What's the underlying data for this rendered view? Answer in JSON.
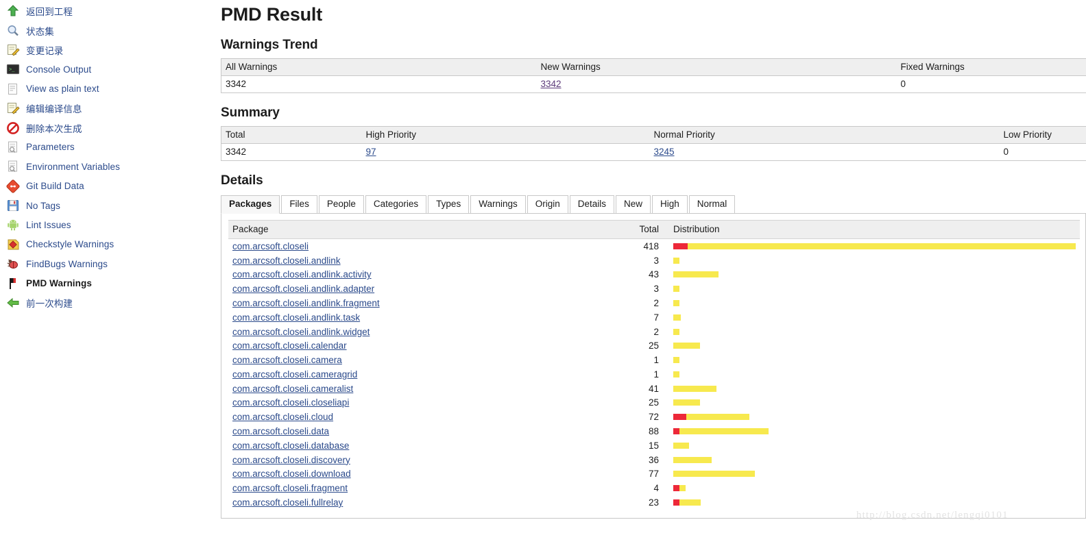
{
  "sidebar": {
    "items": [
      {
        "label": "返回到工程",
        "icon": "up-arrow-green-icon",
        "bold": false
      },
      {
        "label": "状态集",
        "icon": "magnifier-icon",
        "bold": false
      },
      {
        "label": "变更记录",
        "icon": "notepad-pencil-icon",
        "bold": false
      },
      {
        "label": "Console Output",
        "icon": "terminal-icon",
        "bold": false
      },
      {
        "label": "View as plain text",
        "icon": "document-icon",
        "bold": false
      },
      {
        "label": "编辑编译信息",
        "icon": "notepad-pencil-icon",
        "bold": false
      },
      {
        "label": "删除本次生成",
        "icon": "no-entry-icon",
        "bold": false
      },
      {
        "label": "Parameters",
        "icon": "document-search-icon",
        "bold": false
      },
      {
        "label": "Environment Variables",
        "icon": "document-search-icon",
        "bold": false
      },
      {
        "label": "Git Build Data",
        "icon": "git-diamond-icon",
        "bold": false
      },
      {
        "label": "No Tags",
        "icon": "floppy-disk-icon",
        "bold": false
      },
      {
        "label": "Lint Issues",
        "icon": "android-icon",
        "bold": false
      },
      {
        "label": "Checkstyle Warnings",
        "icon": "checkstyle-icon",
        "bold": false
      },
      {
        "label": "FindBugs Warnings",
        "icon": "bug-icon",
        "bold": false
      },
      {
        "label": "PMD Warnings",
        "icon": "pmd-flag-icon",
        "bold": true
      },
      {
        "label": "前一次构建",
        "icon": "left-arrow-green-icon",
        "bold": false
      }
    ]
  },
  "main": {
    "page_title": "PMD Result",
    "trend": {
      "heading": "Warnings Trend",
      "headers": [
        "All Warnings",
        "New Warnings",
        "Fixed Warnings"
      ],
      "row": {
        "all": "3342",
        "new": "3342",
        "fixed": "0"
      }
    },
    "summary": {
      "heading": "Summary",
      "headers": [
        "Total",
        "High Priority",
        "Normal Priority",
        "Low Priority"
      ],
      "row": {
        "total": "3342",
        "high": "97",
        "normal": "3245",
        "low": "0"
      }
    },
    "details": {
      "heading": "Details",
      "tabs": [
        {
          "label": "Packages",
          "active": true
        },
        {
          "label": "Files",
          "active": false
        },
        {
          "label": "People",
          "active": false
        },
        {
          "label": "Categories",
          "active": false
        },
        {
          "label": "Types",
          "active": false
        },
        {
          "label": "Warnings",
          "active": false
        },
        {
          "label": "Origin",
          "active": false
        },
        {
          "label": "Details",
          "active": false
        },
        {
          "label": "New",
          "active": false
        },
        {
          "label": "High",
          "active": false
        },
        {
          "label": "Normal",
          "active": false
        }
      ],
      "columns": [
        "Package",
        "Total",
        "Distribution"
      ],
      "rows": [
        {
          "package": "com.arcsoft.closeli",
          "total": "418",
          "high": 15,
          "normal": 403
        },
        {
          "package": "com.arcsoft.closeli.andlink",
          "total": "3",
          "high": 0,
          "normal": 3
        },
        {
          "package": "com.arcsoft.closeli.andlink.activity",
          "total": "43",
          "high": 0,
          "normal": 43
        },
        {
          "package": "com.arcsoft.closeli.andlink.adapter",
          "total": "3",
          "high": 0,
          "normal": 3
        },
        {
          "package": "com.arcsoft.closeli.andlink.fragment",
          "total": "2",
          "high": 0,
          "normal": 2
        },
        {
          "package": "com.arcsoft.closeli.andlink.task",
          "total": "7",
          "high": 0,
          "normal": 7
        },
        {
          "package": "com.arcsoft.closeli.andlink.widget",
          "total": "2",
          "high": 0,
          "normal": 2
        },
        {
          "package": "com.arcsoft.closeli.calendar",
          "total": "25",
          "high": 0,
          "normal": 25
        },
        {
          "package": "com.arcsoft.closeli.camera",
          "total": "1",
          "high": 0,
          "normal": 1
        },
        {
          "package": "com.arcsoft.closeli.cameragrid",
          "total": "1",
          "high": 0,
          "normal": 1
        },
        {
          "package": "com.arcsoft.closeli.cameralist",
          "total": "41",
          "high": 0,
          "normal": 41
        },
        {
          "package": "com.arcsoft.closeli.closeliapi",
          "total": "25",
          "high": 0,
          "normal": 25
        },
        {
          "package": "com.arcsoft.closeli.cloud",
          "total": "72",
          "high": 12,
          "normal": 60
        },
        {
          "package": "com.arcsoft.closeli.data",
          "total": "88",
          "high": 4,
          "normal": 84
        },
        {
          "package": "com.arcsoft.closeli.database",
          "total": "15",
          "high": 0,
          "normal": 15
        },
        {
          "package": "com.arcsoft.closeli.discovery",
          "total": "36",
          "high": 0,
          "normal": 36
        },
        {
          "package": "com.arcsoft.closeli.download",
          "total": "77",
          "high": 0,
          "normal": 77
        },
        {
          "package": "com.arcsoft.closeli.fragment",
          "total": "4",
          "high": 3,
          "normal": 1
        },
        {
          "package": "com.arcsoft.closeli.fullrelay",
          "total": "23",
          "high": 3,
          "normal": 20
        }
      ]
    }
  },
  "watermark": "http://blog.csdn.net/lengqi0101",
  "colors": {
    "high_priority_bar": "#ED2839",
    "normal_priority_bar": "#F7E94E",
    "link": "#2b4a8b",
    "visited_link": "#5c3a7a",
    "table_header_bg": "#efefef"
  },
  "chart_data": {
    "type": "bar",
    "title": "Distribution",
    "orientation": "horizontal",
    "stacked": true,
    "categories": [
      "com.arcsoft.closeli",
      "com.arcsoft.closeli.andlink",
      "com.arcsoft.closeli.andlink.activity",
      "com.arcsoft.closeli.andlink.adapter",
      "com.arcsoft.closeli.andlink.fragment",
      "com.arcsoft.closeli.andlink.task",
      "com.arcsoft.closeli.andlink.widget",
      "com.arcsoft.closeli.calendar",
      "com.arcsoft.closeli.camera",
      "com.arcsoft.closeli.cameragrid",
      "com.arcsoft.closeli.cameralist",
      "com.arcsoft.closeli.closeliapi",
      "com.arcsoft.closeli.cloud",
      "com.arcsoft.closeli.data",
      "com.arcsoft.closeli.database",
      "com.arcsoft.closeli.discovery",
      "com.arcsoft.closeli.download",
      "com.arcsoft.closeli.fragment",
      "com.arcsoft.closeli.fullrelay"
    ],
    "series": [
      {
        "name": "High Priority",
        "color": "#ED2839",
        "values": [
          15,
          0,
          0,
          0,
          0,
          0,
          0,
          0,
          0,
          0,
          0,
          0,
          12,
          4,
          0,
          0,
          0,
          3,
          3
        ]
      },
      {
        "name": "Normal Priority",
        "color": "#F7E94E",
        "values": [
          403,
          3,
          43,
          3,
          2,
          7,
          2,
          25,
          1,
          1,
          41,
          25,
          60,
          84,
          15,
          36,
          77,
          1,
          20
        ]
      }
    ],
    "totals": [
      418,
      3,
      43,
      3,
      2,
      7,
      2,
      25,
      1,
      1,
      41,
      25,
      72,
      88,
      15,
      36,
      77,
      4,
      23
    ],
    "xlabel": "Warnings",
    "ylabel": "Package",
    "xlim": [
      0,
      418
    ],
    "grid": false,
    "legend": "none"
  }
}
